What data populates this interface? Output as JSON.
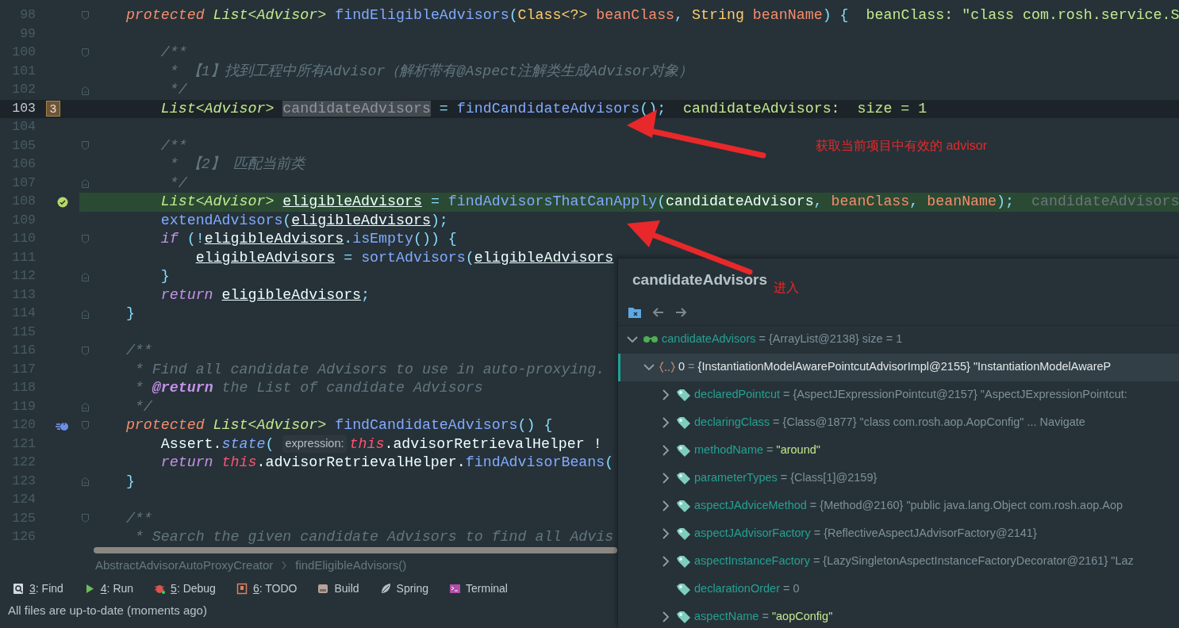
{
  "editor": {
    "lines": [
      {
        "n": "98",
        "kind": "fold-start",
        "current": false,
        "execution": false,
        "tokens": [
          {
            "kind": "mod",
            "text": "    protected "
          },
          {
            "kind": "type",
            "text": "List<Advisor> "
          },
          {
            "kind": "fn",
            "text": "findEligibleAdvisors"
          },
          {
            "kind": "punct",
            "text": "("
          },
          {
            "kind": "cls",
            "text": "Class<?> "
          },
          {
            "kind": "param",
            "text": "beanClass"
          },
          {
            "kind": "punct",
            "text": ", "
          },
          {
            "kind": "cls",
            "text": "String "
          },
          {
            "kind": "param",
            "text": "beanName"
          },
          {
            "kind": "punct",
            "text": ") {"
          },
          {
            "kind": "hint",
            "text": "beanClass: \"class com.rosh.service.S"
          }
        ]
      },
      {
        "n": "99",
        "kind": "plain",
        "current": false,
        "execution": false
      },
      {
        "n": "100",
        "kind": "fold-start",
        "current": false,
        "execution": false,
        "tokens": [
          {
            "kind": "com",
            "text": "        /**"
          }
        ]
      },
      {
        "n": "101",
        "kind": "plain",
        "current": false,
        "execution": false,
        "tokens": [
          {
            "kind": "com",
            "text": "         * 【1】找到工程中所有Advisor（解析带有@Aspect注解类生成Advisor对象）"
          }
        ]
      },
      {
        "n": "102",
        "kind": "fold-end",
        "current": false,
        "execution": false,
        "tokens": [
          {
            "kind": "com",
            "text": "         */"
          }
        ]
      },
      {
        "n": "103",
        "kind": "plain",
        "current": true,
        "execution": false,
        "gutter_badge": "3",
        "tokens": [
          {
            "kind": "type",
            "text": "        List<Advisor> "
          },
          {
            "kind": "sel",
            "text": "candidateAdvisors"
          },
          {
            "kind": "punct",
            "text": " = "
          },
          {
            "kind": "fn",
            "text": "findCandidateAdvisors"
          },
          {
            "kind": "punct",
            "text": "();"
          },
          {
            "kind": "hint",
            "text": "candidateAdvisors:  size = 1"
          }
        ]
      },
      {
        "n": "104",
        "kind": "plain",
        "current": false,
        "execution": false
      },
      {
        "n": "105",
        "kind": "fold-start",
        "current": false,
        "execution": false,
        "tokens": [
          {
            "kind": "com",
            "text": "        /**"
          }
        ]
      },
      {
        "n": "106",
        "kind": "plain",
        "current": false,
        "execution": false,
        "tokens": [
          {
            "kind": "com",
            "text": "         * 【2】 匹配当前类"
          }
        ]
      },
      {
        "n": "107",
        "kind": "fold-end",
        "current": false,
        "execution": false,
        "tokens": [
          {
            "kind": "com",
            "text": "         */"
          }
        ]
      },
      {
        "n": "108",
        "kind": "plain",
        "current": false,
        "execution": true,
        "marker": {
          "kind": "check"
        },
        "tokens": [
          {
            "kind": "type",
            "text": "        List<Advisor> "
          },
          {
            "kind": "var",
            "text": "eligibleAdvisors"
          },
          {
            "kind": "punct",
            "text": " = "
          },
          {
            "kind": "fn",
            "text": "findAdvisorsThatCanApply"
          },
          {
            "kind": "punct",
            "text": "("
          },
          {
            "kind": "plain",
            "text": "candidateAdvisors"
          },
          {
            "kind": "punct",
            "text": ", "
          },
          {
            "kind": "param",
            "text": "beanClass"
          },
          {
            "kind": "punct",
            "text": ", "
          },
          {
            "kind": "param",
            "text": "beanName"
          },
          {
            "kind": "punct",
            "text": ");"
          },
          {
            "kind": "hintdim",
            "text": "candidateAdvisors"
          }
        ]
      },
      {
        "n": "109",
        "kind": "plain",
        "current": false,
        "execution": false,
        "tokens": [
          {
            "kind": "fn",
            "text": "        extendAdvisors"
          },
          {
            "kind": "punct",
            "text": "("
          },
          {
            "kind": "var",
            "text": "eligibleAdvisors"
          },
          {
            "kind": "punct",
            "text": ");"
          }
        ]
      },
      {
        "n": "110",
        "kind": "fold-start",
        "current": false,
        "execution": false,
        "tokens": [
          {
            "kind": "kw",
            "text": "        if"
          },
          {
            "kind": "punct",
            "text": " (!"
          },
          {
            "kind": "var",
            "text": "eligibleAdvisors"
          },
          {
            "kind": "punct",
            "text": "."
          },
          {
            "kind": "fn",
            "text": "isEmpty"
          },
          {
            "kind": "punct",
            "text": "()) {"
          }
        ]
      },
      {
        "n": "111",
        "kind": "plain",
        "current": false,
        "execution": false,
        "tokens": [
          {
            "kind": "var",
            "text": "            eligibleAdvisors"
          },
          {
            "kind": "punct",
            "text": " = "
          },
          {
            "kind": "fn",
            "text": "sortAdvisors"
          },
          {
            "kind": "punct",
            "text": "("
          },
          {
            "kind": "var",
            "text": "eligibleAdvisors"
          }
        ]
      },
      {
        "n": "112",
        "kind": "fold-end",
        "current": false,
        "execution": false,
        "tokens": [
          {
            "kind": "punct",
            "text": "        }"
          }
        ]
      },
      {
        "n": "113",
        "kind": "plain",
        "current": false,
        "execution": false,
        "tokens": [
          {
            "kind": "kw",
            "text": "        return "
          },
          {
            "kind": "var",
            "text": "eligibleAdvisors"
          },
          {
            "kind": "punct",
            "text": ";"
          }
        ]
      },
      {
        "n": "114",
        "kind": "fold-end",
        "current": false,
        "execution": false,
        "tokens": [
          {
            "kind": "punct",
            "text": "    }"
          }
        ]
      },
      {
        "n": "115",
        "kind": "plain",
        "current": false,
        "execution": false
      },
      {
        "n": "116",
        "kind": "fold-start",
        "current": false,
        "execution": false,
        "tokens": [
          {
            "kind": "com",
            "text": "    /**"
          }
        ]
      },
      {
        "n": "117",
        "kind": "plain",
        "current": false,
        "execution": false,
        "tokens": [
          {
            "kind": "com",
            "text": "     * Find all candidate Advisors to use in auto-proxying."
          }
        ]
      },
      {
        "n": "118",
        "kind": "plain",
        "current": false,
        "execution": false,
        "tokens": [
          {
            "kind": "com",
            "text": "     * "
          },
          {
            "kind": "doctag",
            "text": "@return"
          },
          {
            "kind": "com",
            "text": " the List of candidate Advisors"
          }
        ]
      },
      {
        "n": "119",
        "kind": "fold-end",
        "current": false,
        "execution": false,
        "tokens": [
          {
            "kind": "com",
            "text": "     */"
          }
        ]
      },
      {
        "n": "120",
        "kind": "fold-start",
        "current": false,
        "execution": false,
        "marker": {
          "kind": "implementation"
        },
        "tokens": [
          {
            "kind": "mod",
            "text": "    protected "
          },
          {
            "kind": "type",
            "text": "List<Advisor> "
          },
          {
            "kind": "fn",
            "text": "findCandidateAdvisors"
          },
          {
            "kind": "punct",
            "text": "() {"
          }
        ]
      },
      {
        "n": "121",
        "kind": "plain",
        "current": false,
        "execution": false,
        "tokens": [
          {
            "kind": "plain",
            "text": "        Assert."
          },
          {
            "kind": "fni",
            "text": "state"
          },
          {
            "kind": "punct",
            "text": "( "
          },
          {
            "kind": "inlay",
            "text": "expression:"
          },
          {
            "kind": "this",
            "text": "this"
          },
          {
            "kind": "plain",
            "text": ".advisorRetrievalHelper !"
          }
        ]
      },
      {
        "n": "122",
        "kind": "plain",
        "current": false,
        "execution": false,
        "tokens": [
          {
            "kind": "kw",
            "text": "        return "
          },
          {
            "kind": "this",
            "text": "this"
          },
          {
            "kind": "plain",
            "text": ".advisorRetrievalHelper."
          },
          {
            "kind": "fn",
            "text": "findAdvisorBeans"
          },
          {
            "kind": "punct",
            "text": "("
          }
        ]
      },
      {
        "n": "123",
        "kind": "fold-end",
        "current": false,
        "execution": false,
        "tokens": [
          {
            "kind": "punct",
            "text": "    }"
          }
        ]
      },
      {
        "n": "124",
        "kind": "plain",
        "current": false,
        "execution": false
      },
      {
        "n": "125",
        "kind": "fold-start",
        "current": false,
        "execution": false,
        "tokens": [
          {
            "kind": "com",
            "text": "    /**"
          }
        ]
      },
      {
        "n": "126",
        "kind": "plain",
        "current": false,
        "execution": false,
        "tokens": [
          {
            "kind": "com",
            "text": "     * Search the given candidate Advisors to find all Advis"
          }
        ]
      }
    ]
  },
  "breadcrumb": [
    "AbstractAdvisorAutoProxyCreator",
    "findEligibleAdvisors()"
  ],
  "tool_windows": [
    {
      "kind": "find",
      "key": "3",
      "label": ": Find"
    },
    {
      "kind": "run",
      "key": "4",
      "label": ": Run"
    },
    {
      "kind": "debug",
      "key": "5",
      "label": ": Debug"
    },
    {
      "kind": "todo",
      "key": "6",
      "label": ": TODO"
    },
    {
      "kind": "build",
      "label": "Build"
    },
    {
      "kind": "spring",
      "label": "Spring"
    },
    {
      "kind": "terminal",
      "label": "Terminal"
    }
  ],
  "status_bar": "All files are up-to-date (moments ago)",
  "popup": {
    "title": "candidateAdvisors",
    "tree": [
      {
        "kind": "watch",
        "name": "candidateAdvisors",
        "sep": "=",
        "value": {
          "kind": "ref",
          "text": "{ArrayList@2138}  size = 1"
        },
        "expanded": true,
        "leaf": false,
        "selected": false,
        "children": [
          {
            "kind": "object",
            "name": "0",
            "sep": "=",
            "value": {
              "kind": "ref",
              "text": "{InstantiationModelAwarePointcutAdvisorImpl@2155} \"InstantiationModelAwareP"
            },
            "expanded": true,
            "leaf": false,
            "selected": true,
            "children": [
              {
                "kind": "field",
                "name": "declaredPointcut",
                "sep": "=",
                "value": {
                  "kind": "ref",
                  "text": "{AspectJExpressionPointcut@2157} \"AspectJExpressionPointcut:"
                },
                "expanded": false,
                "leaf": false,
                "selected": false
              },
              {
                "kind": "field",
                "name": "declaringClass",
                "sep": "=",
                "value": {
                  "kind": "ref",
                  "text": "{Class@1877} \"class com.rosh.aop.AopConfig\" ... Navigate"
                },
                "expanded": false,
                "leaf": false,
                "selected": false
              },
              {
                "kind": "field",
                "name": "methodName",
                "sep": "=",
                "value": {
                  "kind": "string",
                  "text": "\"around\""
                },
                "expanded": false,
                "leaf": false,
                "selected": false
              },
              {
                "kind": "field",
                "name": "parameterTypes",
                "sep": "=",
                "value": {
                  "kind": "ref",
                  "text": "{Class[1]@2159}"
                },
                "expanded": false,
                "leaf": false,
                "selected": false
              },
              {
                "kind": "field",
                "name": "aspectJAdviceMethod",
                "sep": "=",
                "value": {
                  "kind": "ref",
                  "text": "{Method@2160} \"public java.lang.Object com.rosh.aop.Aop"
                },
                "expanded": false,
                "leaf": false,
                "selected": false
              },
              {
                "kind": "field",
                "name": "aspectJAdvisorFactory",
                "sep": "=",
                "value": {
                  "kind": "ref",
                  "text": "{ReflectiveAspectJAdvisorFactory@2141}"
                },
                "expanded": false,
                "leaf": false,
                "selected": false
              },
              {
                "kind": "field",
                "name": "aspectInstanceFactory",
                "sep": "=",
                "value": {
                  "kind": "ref",
                  "text": "{LazySingletonAspectInstanceFactoryDecorator@2161} \"Laz"
                },
                "expanded": false,
                "leaf": false,
                "selected": false
              },
              {
                "kind": "field",
                "name": "declarationOrder",
                "sep": "=",
                "value": {
                  "kind": "ref",
                  "text": "0"
                },
                "expanded": false,
                "leaf": true,
                "selected": false
              },
              {
                "kind": "field",
                "name": "aspectName",
                "sep": "=",
                "value": {
                  "kind": "string",
                  "text": "\"aopConfig\""
                },
                "expanded": false,
                "leaf": false,
                "selected": false
              }
            ]
          }
        ]
      }
    ]
  },
  "annotations": [
    {
      "text": "获取当前项目中有效的 advisor"
    },
    {
      "text": "进入"
    }
  ]
}
